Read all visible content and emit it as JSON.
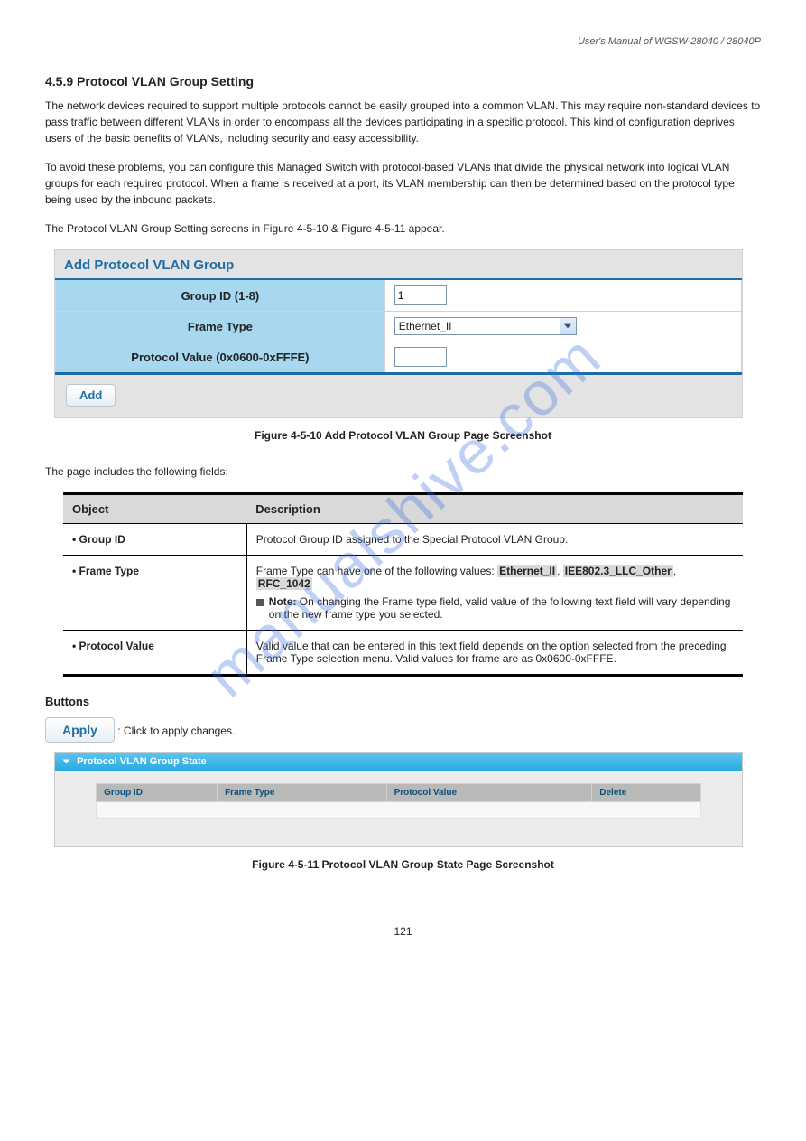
{
  "header": {
    "manual_title": "User's Manual of WGSW-28040 / 28040P"
  },
  "sections": {
    "num_title": "4.5.9 Protocol VLAN Group Setting",
    "intro": "The network devices required to support multiple protocols cannot be easily grouped into a common VLAN. This may require non-standard devices to pass traffic between different VLANs in order to encompass all the devices participating in a specific protocol. This kind of configuration deprives users of the basic benefits of VLANs, including security and easy accessibility.",
    "intro2": "To avoid these problems, you can configure this Managed Switch with protocol-based VLANs that divide the physical network into logical VLAN groups for each required protocol. When a frame is received at a port, its VLAN membership can then be determined based on the protocol type being used by the inbound packets.",
    "lead": "The Protocol VLAN Group Setting screens in Figure 4-5-10 & Figure 4-5-11 appear."
  },
  "form": {
    "panel_title": "Add Protocol VLAN Group",
    "rows": {
      "group_id": {
        "label": "Group ID (1-8)",
        "value": "1"
      },
      "frame_type": {
        "label": "Frame Type",
        "selected": "Ethernet_II"
      },
      "protocol_value": {
        "label": "Protocol Value (0x0600-0xFFFE)",
        "value": ""
      }
    },
    "add_button": "Add"
  },
  "figures": {
    "fig_add_caption": "Figure 4-5-10 Add Protocol VLAN Group Page Screenshot",
    "fig_state_caption": "Figure 4-5-11 Protocol VLAN Group State Page Screenshot"
  },
  "desc": {
    "lead": "The page includes the following fields:",
    "col_object": "Object",
    "col_desc": "Description",
    "rows": {
      "group_id": {
        "obj": "Group ID",
        "text": "Protocol Group ID assigned to the Special Protocol VLAN Group."
      },
      "frame_type": {
        "obj": "Frame Type",
        "line1_pre": "Frame Type can have one of the following values: ",
        "chips": [
          "Ethernet_II",
          "IEE802.3_LLC_Other",
          "RFC_1042"
        ],
        "note_label": "Note: ",
        "note_text": "On changing the Frame type field, valid value of the following text field will vary depending on the new frame type you selected."
      },
      "protocol_value": {
        "obj": "Protocol Value",
        "text": "Valid value that can be entered in this text field depends on the option selected from the preceding Frame Type selection menu. Valid values for frame are as 0x0600-0xFFFE."
      }
    }
  },
  "buttons": {
    "heading": "Buttons",
    "apply_label": "Apply",
    "apply_desc": ": Click to apply changes."
  },
  "state_panel": {
    "title": "Protocol VLAN Group State",
    "cols": {
      "group_id": "Group ID",
      "frame_type": "Frame Type",
      "protocol_value": "Protocol Value",
      "delete": "Delete"
    }
  },
  "footer": {
    "page_number": "121"
  },
  "watermark": "manualshive.com"
}
